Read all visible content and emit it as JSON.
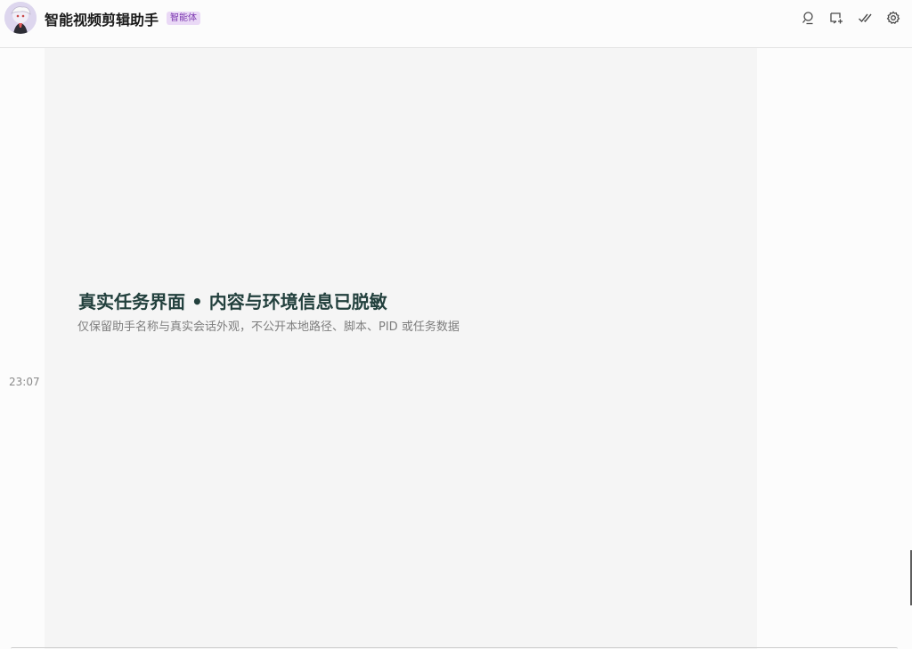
{
  "header": {
    "title": "智能视频剪辑助手",
    "badge": "智能体",
    "icons": [
      "search-user-icon",
      "new-chat-icon",
      "check-all-icon",
      "settings-icon"
    ]
  },
  "conversation": {
    "time": "23:07",
    "card": {
      "title": "真实任务界面 • 内容与环境信息已脱敏",
      "subtitle": "仅保留助手名称与真实会话外观，不公开本地路径、脚本、PID 或任务数据"
    }
  },
  "colors": {
    "title": "#22403d",
    "badge_text": "#7d3ab0",
    "badge_bg": "#ead9f6",
    "card_bg": "#f5f5f5"
  }
}
